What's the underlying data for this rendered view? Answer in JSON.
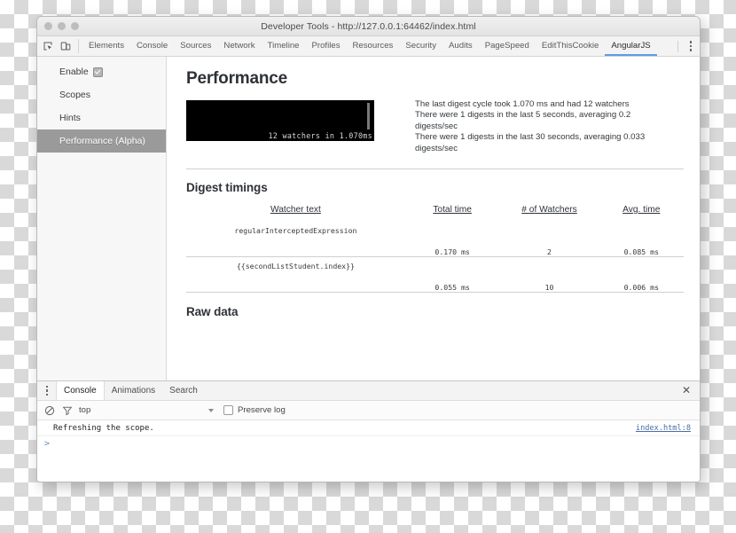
{
  "window": {
    "title": "Developer Tools - http://127.0.0.1:64462/index.html"
  },
  "devtools": {
    "toolbar_icons": [
      {
        "name": "inspect-element-icon"
      },
      {
        "name": "device-toolbar-icon"
      }
    ],
    "tabs": [
      {
        "label": "Elements",
        "active": false
      },
      {
        "label": "Console",
        "active": false
      },
      {
        "label": "Sources",
        "active": false
      },
      {
        "label": "Network",
        "active": false
      },
      {
        "label": "Timeline",
        "active": false
      },
      {
        "label": "Profiles",
        "active": false
      },
      {
        "label": "Resources",
        "active": false
      },
      {
        "label": "Security",
        "active": false
      },
      {
        "label": "Audits",
        "active": false
      },
      {
        "label": "PageSpeed",
        "active": false
      },
      {
        "label": "EditThisCookie",
        "active": false
      },
      {
        "label": "AngularJS",
        "active": true
      }
    ],
    "more_menu": "more-options-icon"
  },
  "sidebar": {
    "items": [
      {
        "label": "Enable",
        "checkbox": true,
        "checked": true,
        "selected": false
      },
      {
        "label": "Scopes",
        "checkbox": false,
        "selected": false
      },
      {
        "label": "Hints",
        "checkbox": false,
        "selected": false
      },
      {
        "label": "Performance (Alpha)",
        "checkbox": false,
        "selected": true
      }
    ]
  },
  "main": {
    "performance": {
      "title": "Performance",
      "graph_label": "12 watchers in 1.070ms",
      "stats": [
        "The last digest cycle took 1.070 ms and had 12 watchers",
        "There were 1 digests in the last 5 seconds, averaging 0.2 digests/sec",
        "There were 1 digests in the last 30 seconds, averaging 0.033 digests/sec"
      ]
    },
    "digest": {
      "title": "Digest timings",
      "columns": [
        "Watcher text",
        "Total time",
        "# of Watchers",
        "Avg. time"
      ],
      "rows": [
        {
          "watcher": "regularInterceptedExpression",
          "total_time": "0.170 ms",
          "watchers": "2",
          "avg_time": "0.085 ms"
        },
        {
          "watcher": "{{secondListStudent.index}}",
          "total_time": "0.055 ms",
          "watchers": "10",
          "avg_time": "0.006 ms"
        }
      ]
    },
    "raw_data": {
      "title": "Raw data"
    }
  },
  "drawer": {
    "tabs": [
      {
        "label": "Console",
        "active": true
      },
      {
        "label": "Animations",
        "active": false
      },
      {
        "label": "Search",
        "active": false
      }
    ],
    "close_label": "✕",
    "toolbar": {
      "clear_icon": "clear-console-icon",
      "filter_icon": "filter-icon",
      "context": "top",
      "preserve_log_label": "Preserve log",
      "preserve_log_checked": false
    },
    "messages": [
      {
        "text": "Refreshing the scope.",
        "source": "index.html:8"
      }
    ],
    "prompt": ">"
  }
}
